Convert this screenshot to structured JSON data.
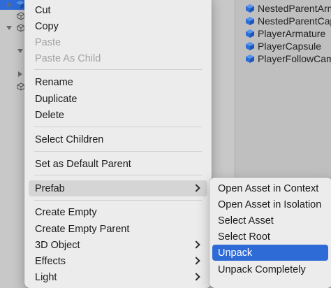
{
  "menu": {
    "items": [
      {
        "label": "Cut"
      },
      {
        "label": "Copy"
      },
      {
        "label": "Paste"
      },
      {
        "label": "Paste As Child"
      },
      {
        "label": "Rename"
      },
      {
        "label": "Duplicate"
      },
      {
        "label": "Delete"
      },
      {
        "label": "Select Children"
      },
      {
        "label": "Set as Default Parent"
      },
      {
        "label": "Prefab"
      },
      {
        "label": "Create Empty"
      },
      {
        "label": "Create Empty Parent"
      },
      {
        "label": "3D Object"
      },
      {
        "label": "Effects"
      },
      {
        "label": "Light"
      }
    ],
    "disabled": [
      "Paste",
      "Paste As Child"
    ],
    "hovered": "Prefab"
  },
  "submenu": {
    "items": [
      {
        "label": "Open Asset in Context"
      },
      {
        "label": "Open Asset in Isolation"
      },
      {
        "label": "Select Asset"
      },
      {
        "label": "Select Root"
      },
      {
        "label": "Unpack"
      },
      {
        "label": "Unpack Completely"
      }
    ],
    "active": "Unpack"
  },
  "right_panel": {
    "items": [
      {
        "label": "NestedParentArm",
        "icon": "prefab-cube-icon"
      },
      {
        "label": "NestedParentCap",
        "icon": "prefab-cube-icon"
      },
      {
        "label": "PlayerArmature",
        "icon": "prefab-cube-icon"
      },
      {
        "label": "PlayerCapsule",
        "icon": "prefab-cube-icon"
      },
      {
        "label": "PlayerFollowCam",
        "icon": "prefab-cube-icon"
      }
    ]
  },
  "colors": {
    "accent": "#2f6bd6",
    "menu_bg": "#ececec",
    "prefab_blue": "#2a6fd9"
  }
}
